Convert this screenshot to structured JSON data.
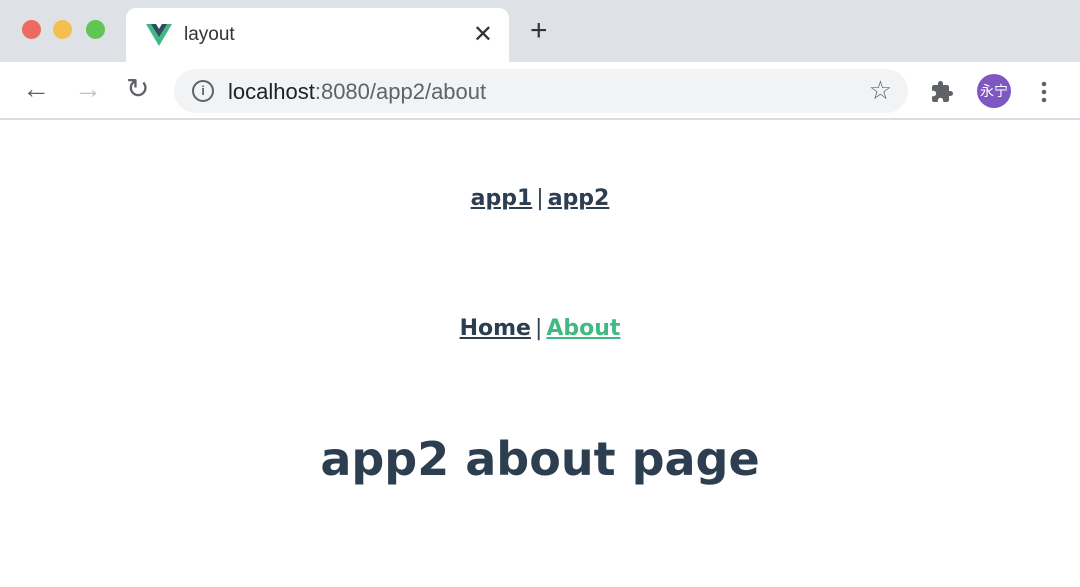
{
  "browser": {
    "tab_title": "layout",
    "url_host": "localhost",
    "url_path": ":8080/app2/about",
    "avatar_text": "永宁",
    "colors": {
      "close": "#ed6a5e",
      "minimize": "#f5bf4f",
      "maximize": "#61c554",
      "avatar": "#7e57c2"
    }
  },
  "app_nav": {
    "items": [
      {
        "label": "app1"
      },
      {
        "label": "app2"
      }
    ],
    "separator": "|"
  },
  "page_nav": {
    "items": [
      {
        "label": "Home"
      },
      {
        "label": "About",
        "active": true
      }
    ],
    "separator": "|"
  },
  "page": {
    "heading": "app2 about page"
  },
  "colors": {
    "text": "#2c3e50",
    "active_link": "#42b983"
  }
}
